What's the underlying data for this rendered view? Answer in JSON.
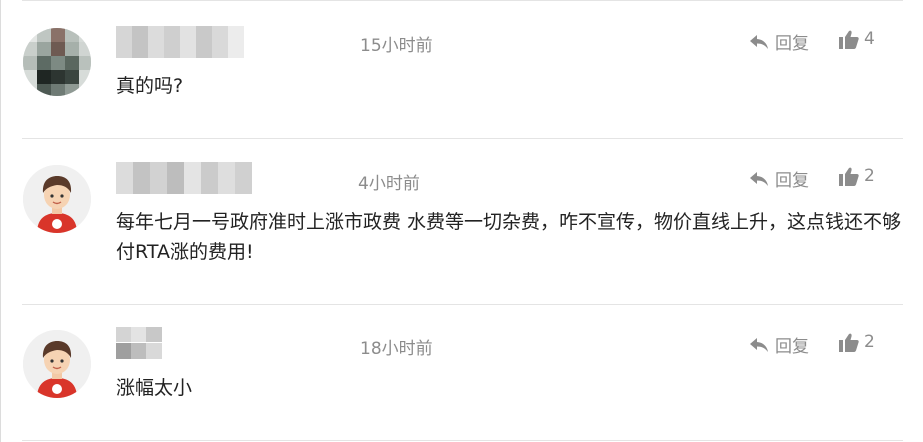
{
  "comments": [
    {
      "time": "15小时前",
      "reply_label": "回复",
      "like_count": "4",
      "text": "真的吗?"
    },
    {
      "time": "4小时前",
      "reply_label": "回复",
      "like_count": "2",
      "text": "每年七月一号政府准时上涨市政费 水费等一切杂费，咋不宣传，物价直线上升，这点钱还不够付RTA涨的费用!"
    },
    {
      "time": "18小时前",
      "reply_label": "回复",
      "like_count": "2",
      "text": "涨幅太小"
    }
  ],
  "icons": {
    "reply": "reply-arrow-icon",
    "like": "thumbs-up-icon"
  },
  "colors": {
    "muted": "#8c8c8c",
    "text": "#222222",
    "divider": "#e4e4e4",
    "avatar_shirt": "#d9352a"
  }
}
